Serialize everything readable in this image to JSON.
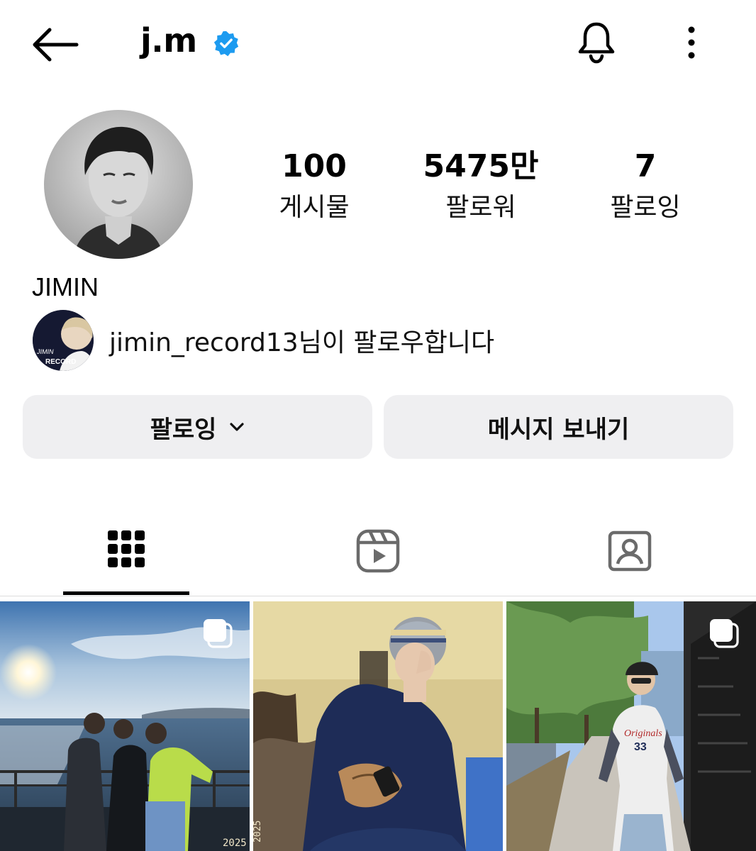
{
  "header": {
    "username": "j.m",
    "verified": true
  },
  "profile": {
    "display_name": "JIMIN",
    "stats": {
      "posts_count": "100",
      "posts_label": "게시물",
      "followers_count": "5475만",
      "followers_label": "팔로워",
      "following_count": "7",
      "following_label": "팔로잉"
    },
    "mutual_follower": {
      "text": "jimin_record13님이 팔로우합니다",
      "avatar_text": "JIMIN RECORD"
    }
  },
  "actions": {
    "following_label": "팔로잉",
    "message_label": "메시지 보내기"
  },
  "tabs": [
    {
      "name": "grid",
      "icon": "grid-icon",
      "active": true
    },
    {
      "name": "reels",
      "icon": "reels-icon",
      "active": false
    },
    {
      "name": "tagged",
      "icon": "tagged-icon",
      "active": false
    }
  ],
  "posts": [
    {
      "type": "carousel",
      "year_label": "2025"
    },
    {
      "type": "single",
      "year_label": "2025"
    },
    {
      "type": "carousel",
      "year_label": ""
    }
  ],
  "colors": {
    "verified_blue": "#1d9bf0",
    "button_bg": "#efeff1",
    "text": "#000000"
  }
}
